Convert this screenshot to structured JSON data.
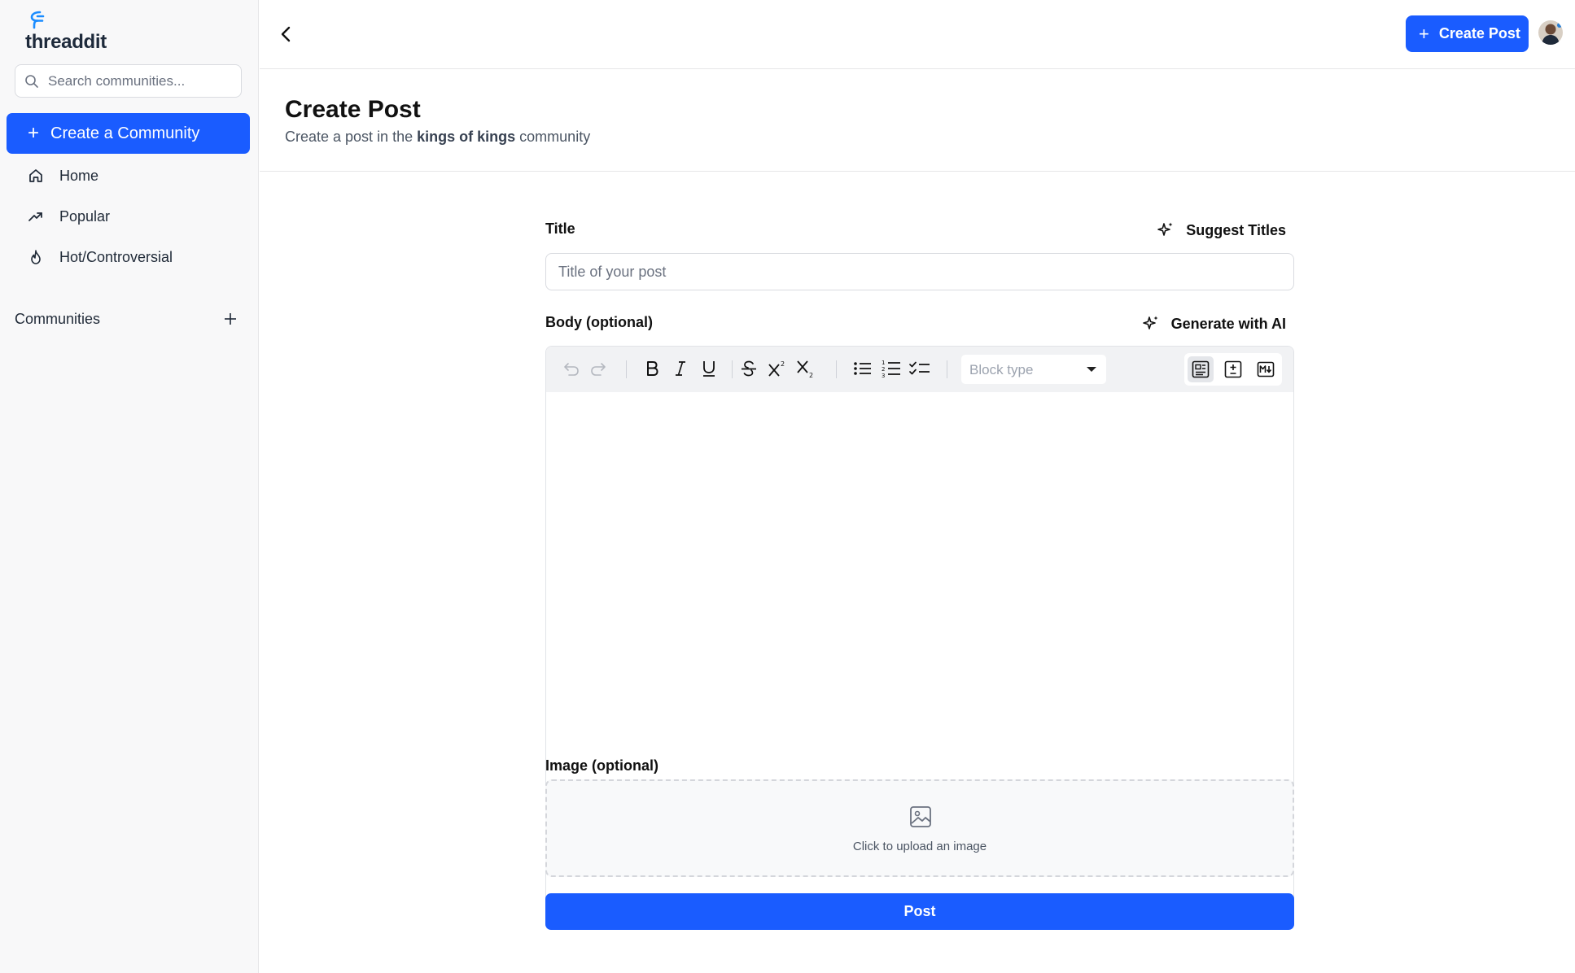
{
  "app": {
    "logo_text": "threaddit"
  },
  "sidebar": {
    "search_placeholder": "Search communities...",
    "create_community_label": "Create a Community",
    "items": [
      {
        "label": "Home",
        "icon": "home-icon"
      },
      {
        "label": "Popular",
        "icon": "trending-icon"
      },
      {
        "label": "Hot/Controversial",
        "icon": "flame-icon"
      }
    ],
    "communities_label": "Communities"
  },
  "topbar": {
    "create_post_label": "Create Post"
  },
  "page": {
    "title": "Create Post",
    "subtitle_prefix": "Create a post in the",
    "community_name": "kings of kings",
    "subtitle_suffix": "community"
  },
  "form": {
    "title_label": "Title",
    "suggest_titles_label": "Suggest Titles",
    "title_placeholder": "Title of your post",
    "body_label": "Body (optional)",
    "generate_ai_label": "Generate with AI",
    "block_type_placeholder": "Block type",
    "image_label": "Image (optional)",
    "upload_label": "Click to upload an image",
    "post_label": "Post"
  },
  "colors": {
    "accent": "#1a5cff",
    "sidebar_bg": "#f8f8f9"
  }
}
